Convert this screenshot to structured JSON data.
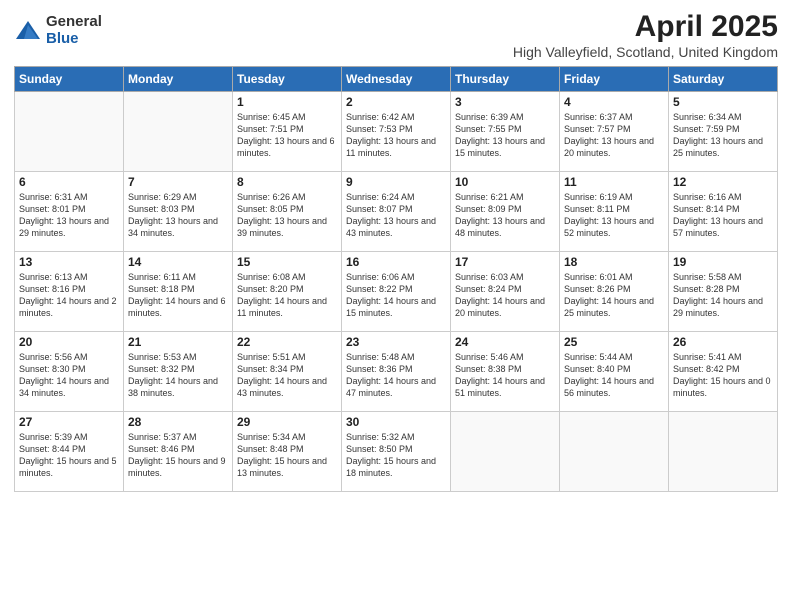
{
  "logo": {
    "general": "General",
    "blue": "Blue"
  },
  "title": "April 2025",
  "subtitle": "High Valleyfield, Scotland, United Kingdom",
  "days_of_week": [
    "Sunday",
    "Monday",
    "Tuesday",
    "Wednesday",
    "Thursday",
    "Friday",
    "Saturday"
  ],
  "weeks": [
    [
      {
        "day": "",
        "info": ""
      },
      {
        "day": "",
        "info": ""
      },
      {
        "day": "1",
        "info": "Sunrise: 6:45 AM\nSunset: 7:51 PM\nDaylight: 13 hours and 6 minutes."
      },
      {
        "day": "2",
        "info": "Sunrise: 6:42 AM\nSunset: 7:53 PM\nDaylight: 13 hours and 11 minutes."
      },
      {
        "day": "3",
        "info": "Sunrise: 6:39 AM\nSunset: 7:55 PM\nDaylight: 13 hours and 15 minutes."
      },
      {
        "day": "4",
        "info": "Sunrise: 6:37 AM\nSunset: 7:57 PM\nDaylight: 13 hours and 20 minutes."
      },
      {
        "day": "5",
        "info": "Sunrise: 6:34 AM\nSunset: 7:59 PM\nDaylight: 13 hours and 25 minutes."
      }
    ],
    [
      {
        "day": "6",
        "info": "Sunrise: 6:31 AM\nSunset: 8:01 PM\nDaylight: 13 hours and 29 minutes."
      },
      {
        "day": "7",
        "info": "Sunrise: 6:29 AM\nSunset: 8:03 PM\nDaylight: 13 hours and 34 minutes."
      },
      {
        "day": "8",
        "info": "Sunrise: 6:26 AM\nSunset: 8:05 PM\nDaylight: 13 hours and 39 minutes."
      },
      {
        "day": "9",
        "info": "Sunrise: 6:24 AM\nSunset: 8:07 PM\nDaylight: 13 hours and 43 minutes."
      },
      {
        "day": "10",
        "info": "Sunrise: 6:21 AM\nSunset: 8:09 PM\nDaylight: 13 hours and 48 minutes."
      },
      {
        "day": "11",
        "info": "Sunrise: 6:19 AM\nSunset: 8:11 PM\nDaylight: 13 hours and 52 minutes."
      },
      {
        "day": "12",
        "info": "Sunrise: 6:16 AM\nSunset: 8:14 PM\nDaylight: 13 hours and 57 minutes."
      }
    ],
    [
      {
        "day": "13",
        "info": "Sunrise: 6:13 AM\nSunset: 8:16 PM\nDaylight: 14 hours and 2 minutes."
      },
      {
        "day": "14",
        "info": "Sunrise: 6:11 AM\nSunset: 8:18 PM\nDaylight: 14 hours and 6 minutes."
      },
      {
        "day": "15",
        "info": "Sunrise: 6:08 AM\nSunset: 8:20 PM\nDaylight: 14 hours and 11 minutes."
      },
      {
        "day": "16",
        "info": "Sunrise: 6:06 AM\nSunset: 8:22 PM\nDaylight: 14 hours and 15 minutes."
      },
      {
        "day": "17",
        "info": "Sunrise: 6:03 AM\nSunset: 8:24 PM\nDaylight: 14 hours and 20 minutes."
      },
      {
        "day": "18",
        "info": "Sunrise: 6:01 AM\nSunset: 8:26 PM\nDaylight: 14 hours and 25 minutes."
      },
      {
        "day": "19",
        "info": "Sunrise: 5:58 AM\nSunset: 8:28 PM\nDaylight: 14 hours and 29 minutes."
      }
    ],
    [
      {
        "day": "20",
        "info": "Sunrise: 5:56 AM\nSunset: 8:30 PM\nDaylight: 14 hours and 34 minutes."
      },
      {
        "day": "21",
        "info": "Sunrise: 5:53 AM\nSunset: 8:32 PM\nDaylight: 14 hours and 38 minutes."
      },
      {
        "day": "22",
        "info": "Sunrise: 5:51 AM\nSunset: 8:34 PM\nDaylight: 14 hours and 43 minutes."
      },
      {
        "day": "23",
        "info": "Sunrise: 5:48 AM\nSunset: 8:36 PM\nDaylight: 14 hours and 47 minutes."
      },
      {
        "day": "24",
        "info": "Sunrise: 5:46 AM\nSunset: 8:38 PM\nDaylight: 14 hours and 51 minutes."
      },
      {
        "day": "25",
        "info": "Sunrise: 5:44 AM\nSunset: 8:40 PM\nDaylight: 14 hours and 56 minutes."
      },
      {
        "day": "26",
        "info": "Sunrise: 5:41 AM\nSunset: 8:42 PM\nDaylight: 15 hours and 0 minutes."
      }
    ],
    [
      {
        "day": "27",
        "info": "Sunrise: 5:39 AM\nSunset: 8:44 PM\nDaylight: 15 hours and 5 minutes."
      },
      {
        "day": "28",
        "info": "Sunrise: 5:37 AM\nSunset: 8:46 PM\nDaylight: 15 hours and 9 minutes."
      },
      {
        "day": "29",
        "info": "Sunrise: 5:34 AM\nSunset: 8:48 PM\nDaylight: 15 hours and 13 minutes."
      },
      {
        "day": "30",
        "info": "Sunrise: 5:32 AM\nSunset: 8:50 PM\nDaylight: 15 hours and 18 minutes."
      },
      {
        "day": "",
        "info": ""
      },
      {
        "day": "",
        "info": ""
      },
      {
        "day": "",
        "info": ""
      }
    ]
  ]
}
